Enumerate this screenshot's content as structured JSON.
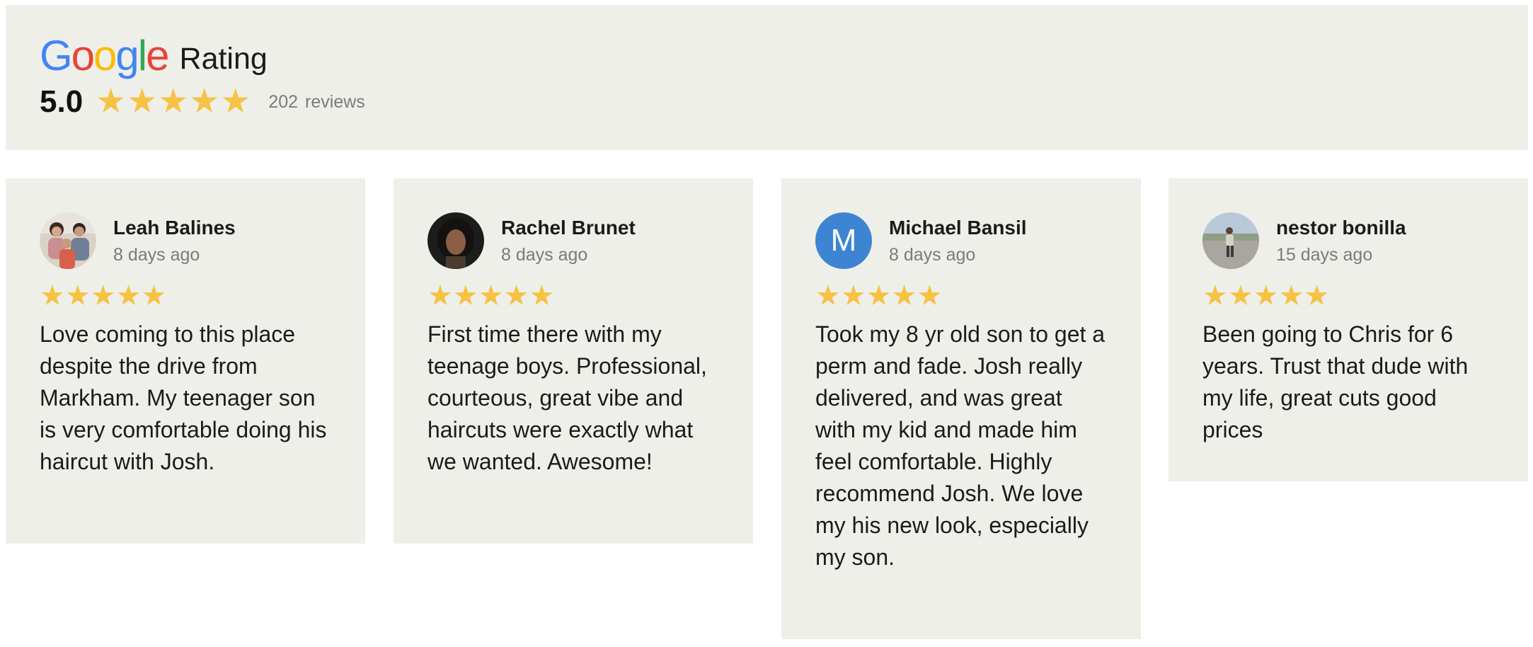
{
  "header": {
    "logo_letters": [
      "G",
      "o",
      "o",
      "g",
      "l",
      "e"
    ],
    "logo_colors": [
      "#4285f4",
      "#ea4335",
      "#fbbc05",
      "#4285f4",
      "#34a853",
      "#ea4335"
    ],
    "rating_label": "Rating",
    "score": "5.0",
    "stars": 5,
    "review_count": "202",
    "reviews_label": "reviews"
  },
  "colors": {
    "panel_bg": "#efefea",
    "star": "#f6c244",
    "muted_text": "#7a7a7a",
    "avatar_m_bg": "#3d85d3"
  },
  "reviews": [
    {
      "name": "Leah Balines",
      "ago": "8 days ago",
      "stars": 5,
      "avatar": "family-photo-avatar",
      "text": "Love coming to this place despite the drive from Markham. My teenager son is very comfortable doing his haircut with Josh."
    },
    {
      "name": "Rachel Brunet",
      "ago": "8 days ago",
      "stars": 5,
      "avatar": "portrait-photo-avatar",
      "text": "First time there with my teenage boys. Professional, courteous, great vibe and haircuts were exactly what we wanted. Awesome!"
    },
    {
      "name": "Michael Bansil",
      "ago": "8 days ago",
      "stars": 5,
      "avatar_letter": "M",
      "text": "Took my 8 yr old son to get a perm and fade. Josh really delivered, and was great with my kid and made him feel comfortable. Highly recommend Josh. We love my his new look, especially my son."
    },
    {
      "name": "nestor bonilla",
      "ago": "15 days ago",
      "stars": 5,
      "avatar": "outdoor-photo-avatar",
      "text": "Been going to Chris for 6 years. Trust that dude with my life, great cuts good prices"
    }
  ]
}
